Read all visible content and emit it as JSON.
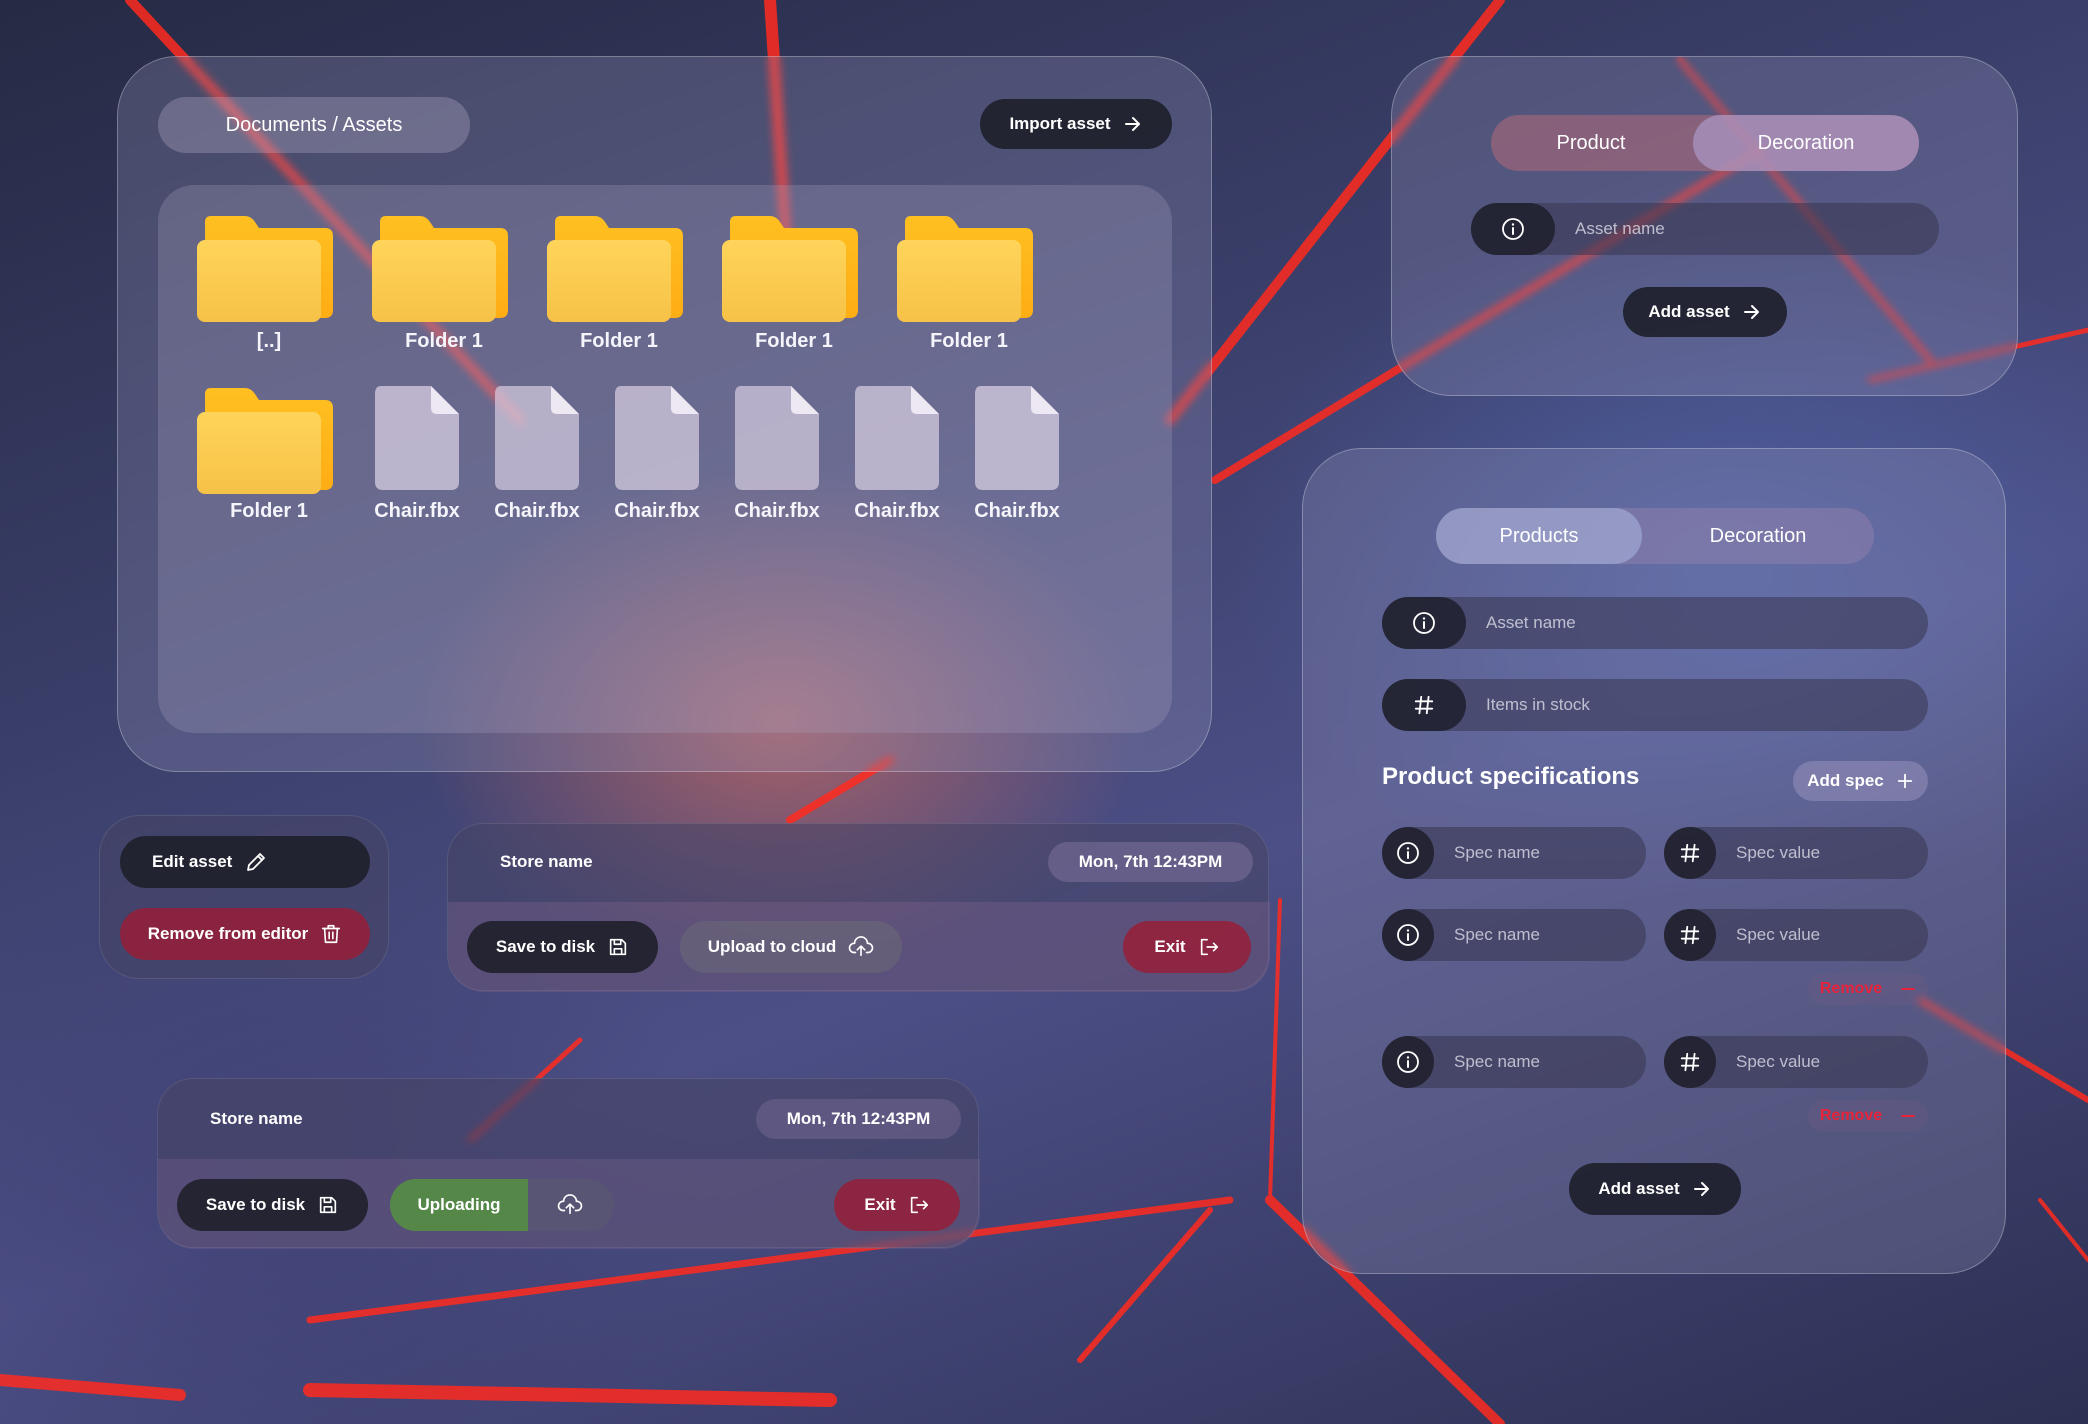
{
  "colors": {
    "accent_red": "#961e37",
    "accent_green": "#508c46",
    "dark": "#20212d",
    "remove_red": "#e8233a",
    "folder_yellow": "#fdc84a"
  },
  "file_browser": {
    "breadcrumb": "Documents / Assets",
    "import_label": "Import asset",
    "folders_row1": [
      "[..]",
      "Folder 1",
      "Folder 1",
      "Folder 1",
      "Folder 1"
    ],
    "folder_row2": "Folder 1",
    "files": [
      "Chair.fbx",
      "Chair.fbx",
      "Chair.fbx",
      "Chair.fbx",
      "Chair.fbx",
      "Chair.fbx"
    ]
  },
  "top_form": {
    "tabs": [
      "Product",
      "Decoration"
    ],
    "asset_name_placeholder": "Asset name",
    "add_asset_label": "Add asset"
  },
  "edit_panel": {
    "edit_label": "Edit asset",
    "remove_label": "Remove from editor"
  },
  "store_bar_1": {
    "store_name": "Store name",
    "timestamp": "Mon, 7th 12:43PM",
    "save_label": "Save to disk",
    "upload_label": "Upload to cloud",
    "exit_label": "Exit"
  },
  "store_bar_2": {
    "store_name": "Store name",
    "timestamp": "Mon, 7th 12:43PM",
    "save_label": "Save to disk",
    "uploading_label": "Uploading",
    "exit_label": "Exit"
  },
  "spec_form": {
    "tabs": [
      "Products",
      "Decoration"
    ],
    "asset_name_placeholder": "Asset name",
    "stock_placeholder": "Items in stock",
    "section_title": "Product specifications",
    "add_spec_label": "Add spec",
    "spec_name_placeholder": "Spec name",
    "spec_value_placeholder": "Spec value",
    "remove_label": "Remove",
    "add_asset_label": "Add asset"
  },
  "icons": [
    "arrow-right-icon",
    "folder-icon",
    "file-icon",
    "info-icon",
    "hash-icon",
    "pencil-icon",
    "trash-icon",
    "save-icon",
    "cloud-upload-icon",
    "exit-icon",
    "plus-icon",
    "minus-icon"
  ]
}
